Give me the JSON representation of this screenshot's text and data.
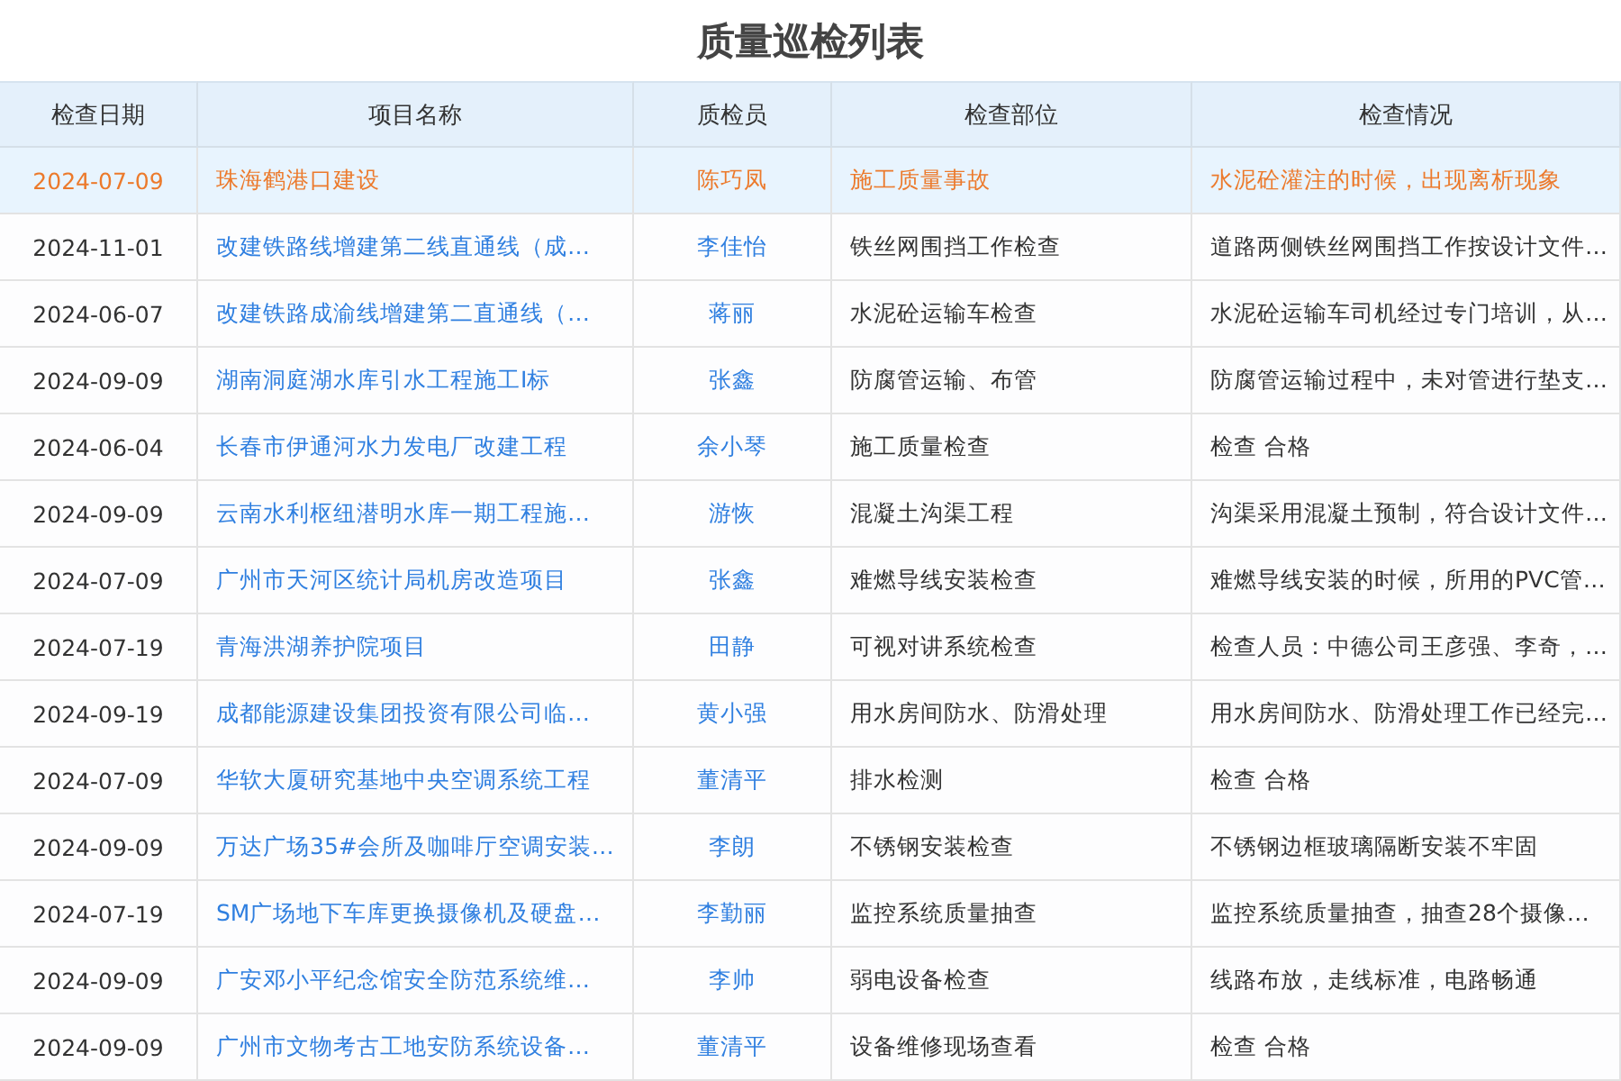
{
  "title": "质量巡检列表",
  "columns": [
    "检查日期",
    "项目名称",
    "质检员",
    "检查部位",
    "检查情况"
  ],
  "rows": [
    {
      "selected": true,
      "cells": [
        "2024-07-09",
        "珠海鹤港口建设",
        "陈巧凤",
        "施工质量事故",
        "水泥砼灌注的时候，出现离析现象"
      ]
    },
    {
      "selected": false,
      "cells": [
        "2024-11-01",
        "改建铁路线增建第二线直通线（成…",
        "李佳怡",
        "铁丝网围挡工作检查",
        "道路两侧铁丝网围挡工作按设计文件…"
      ]
    },
    {
      "selected": false,
      "cells": [
        "2024-06-07",
        "改建铁路成渝线增建第二直通线（…",
        "蒋丽",
        "水泥砼运输车检查",
        "水泥砼运输车司机经过专门培训，从…"
      ]
    },
    {
      "selected": false,
      "cells": [
        "2024-09-09",
        "湖南洞庭湖水库引水工程施工Ⅰ标",
        "张鑫",
        "防腐管运输、布管",
        "防腐管运输过程中，未对管进行垫支…"
      ]
    },
    {
      "selected": false,
      "cells": [
        "2024-06-04",
        "长春市伊通河水力发电厂改建工程",
        "余小琴",
        "施工质量检查",
        "检查 合格"
      ]
    },
    {
      "selected": false,
      "cells": [
        "2024-09-09",
        "云南水利枢纽潜明水库一期工程施…",
        "游恢",
        "混凝土沟渠工程",
        "沟渠采用混凝土预制，符合设计文件…"
      ]
    },
    {
      "selected": false,
      "cells": [
        "2024-07-09",
        "广州市天河区统计局机房改造项目",
        "张鑫",
        "难燃导线安装检查",
        "难燃导线安装的时候，所用的PVC管…"
      ]
    },
    {
      "selected": false,
      "cells": [
        "2024-07-19",
        "青海洪湖养护院项目",
        "田静",
        "可视对讲系统检查",
        "检查人员：中德公司王彦强、李奇，…"
      ]
    },
    {
      "selected": false,
      "cells": [
        "2024-09-19",
        "成都能源建设集团投资有限公司临…",
        "黄小强",
        "用水房间防水、防滑处理",
        "用水房间防水、防滑处理工作已经完…"
      ]
    },
    {
      "selected": false,
      "cells": [
        "2024-07-09",
        "华软大厦研究基地中央空调系统工程",
        "董清平",
        "排水检测",
        "检查 合格"
      ]
    },
    {
      "selected": false,
      "cells": [
        "2024-09-09",
        "万达广场35#会所及咖啡厅空调安装…",
        "李朗",
        "不锈钢安装检查",
        "不锈钢边框玻璃隔断安装不牢固"
      ]
    },
    {
      "selected": false,
      "cells": [
        "2024-07-19",
        "SM广场地下车库更换摄像机及硬盘…",
        "李勤丽",
        "监控系统质量抽查",
        "监控系统质量抽查，抽查28个摄像…"
      ]
    },
    {
      "selected": false,
      "cells": [
        "2024-09-09",
        "广安邓小平纪念馆安全防范系统维…",
        "李帅",
        "弱电设备检查",
        "线路布放，走线标准，电路畅通"
      ]
    },
    {
      "selected": false,
      "cells": [
        "2024-09-09",
        "广州市文物考古工地安防系统设备…",
        "董清平",
        "设备维修现场查看",
        "检查 合格"
      ]
    }
  ]
}
